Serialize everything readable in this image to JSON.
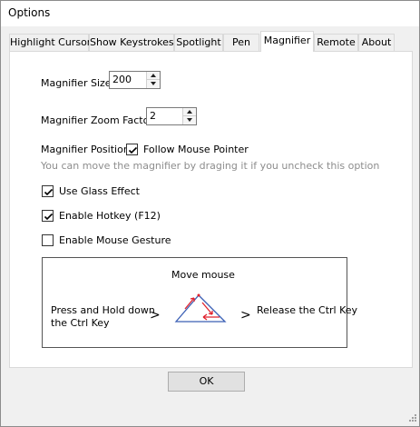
{
  "window": {
    "title": "Options"
  },
  "tabs": [
    {
      "label": "Highlight Cursor"
    },
    {
      "label": "Show Keystrokes"
    },
    {
      "label": "Spotlight"
    },
    {
      "label": "Pen"
    },
    {
      "label": "Magnifier"
    },
    {
      "label": "Remote"
    },
    {
      "label": "About"
    }
  ],
  "active_tab": "Magnifier",
  "magnifier": {
    "size_label": "Magnifier Size",
    "size_value": "200",
    "zoom_label": "Magnifier Zoom Factor",
    "zoom_value": "2",
    "position_label": "Magnifier Position",
    "follow_label": "Follow Mouse Pointer",
    "follow_checked": true,
    "hint": "You can move the magnifier by draging it if you uncheck this option",
    "glass_label": "Use Glass Effect",
    "glass_checked": true,
    "hotkey_label": "Enable Hotkey (F12)",
    "hotkey_checked": true,
    "gesture_label": "Enable Mouse Gesture",
    "gesture_checked": false
  },
  "gesture_diagram": {
    "move_text": "Move mouse",
    "press_line1": "Press and Hold down",
    "press_line2": "the Ctrl Key",
    "gt1": ">",
    "gt2": ">",
    "release_text": "Release the Ctrl Key",
    "triangle_color": "#3b5fb5",
    "arrow_color": "#e0202c"
  },
  "footer": {
    "ok_label": "OK"
  }
}
